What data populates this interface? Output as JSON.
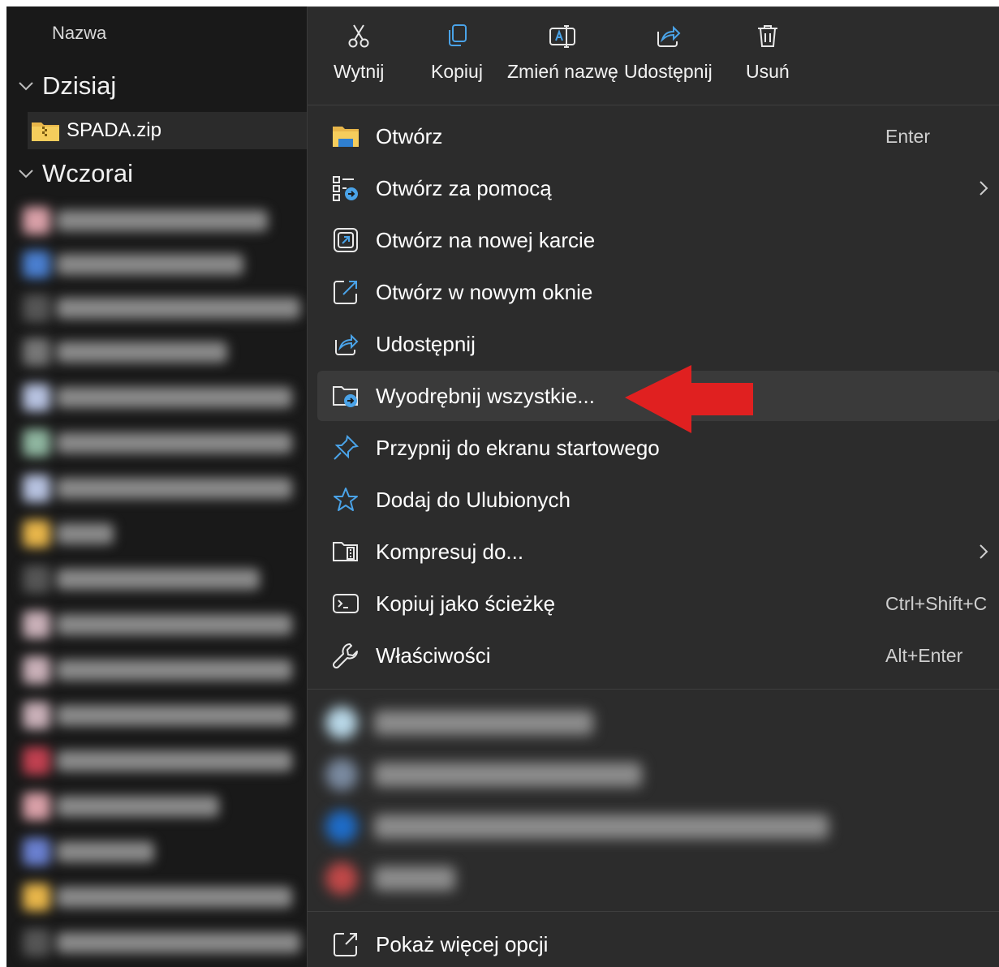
{
  "explorer": {
    "column_header": "Nazwa",
    "groups": [
      {
        "label": "Dzisiaj"
      },
      {
        "label": "Wczorai"
      }
    ],
    "selected_file": {
      "name": "SPADA.zip",
      "icon": "zip-folder-icon"
    }
  },
  "toolbar": {
    "items": [
      {
        "label": "Wytnij",
        "icon": "scissors-icon"
      },
      {
        "label": "Kopiuj",
        "icon": "copy-icon"
      },
      {
        "label": "Zmień nazwę",
        "icon": "rename-icon"
      },
      {
        "label": "Udostępnij",
        "icon": "share-icon"
      },
      {
        "label": "Usuń",
        "icon": "trash-icon"
      }
    ]
  },
  "menu": {
    "items": [
      {
        "label": "Otwórz",
        "shortcut": "Enter",
        "icon": "folder-open-icon"
      },
      {
        "label": "Otwórz za pomocą",
        "icon": "open-with-icon",
        "submenu": true
      },
      {
        "label": "Otwórz na nowej karcie",
        "icon": "new-tab-icon"
      },
      {
        "label": "Otwórz w nowym oknie",
        "icon": "new-window-icon"
      },
      {
        "label": "Udostępnij",
        "icon": "share-icon"
      },
      {
        "label": "Wyodrębnij wszystkie...",
        "icon": "extract-icon",
        "highlighted": true
      },
      {
        "label": "Przypnij do ekranu startowego",
        "icon": "pin-icon"
      },
      {
        "label": "Dodaj do Ulubionych",
        "icon": "star-icon"
      },
      {
        "label": "Kompresuj do...",
        "icon": "compress-icon",
        "submenu": true
      },
      {
        "label": "Kopiuj jako ścieżkę",
        "shortcut": "Ctrl+Shift+C",
        "icon": "copy-path-icon"
      },
      {
        "label": "Właściwości",
        "shortcut": "Alt+Enter",
        "icon": "wrench-icon"
      }
    ],
    "footer": {
      "label": "Pokaż więcej opcji",
      "icon": "show-more-icon"
    }
  },
  "colors": {
    "background": "#191919",
    "menu_background": "#2c2c2c",
    "highlight": "#3a3a3a",
    "accent_blue": "#4aa3e8",
    "arrow_red": "#e02020"
  }
}
